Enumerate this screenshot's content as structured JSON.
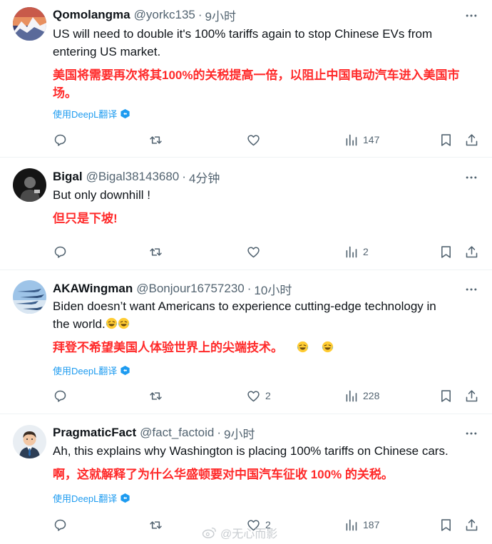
{
  "tweets": [
    {
      "name": "Qomolangma",
      "handle": "@yorkc135",
      "time": "9小时",
      "text_line1": "US will need to double it's 100% tariffs again to stop Chinese EVs from",
      "text_line2": "entering  US market.",
      "translation_line1": "美国将需要再次将其100%的关税提高一倍，以阻止中国电动汽车进入美国市",
      "translation_line2": "场。",
      "translate_link": "使用DeepL翻译",
      "likes": "",
      "views": "147"
    },
    {
      "name": "Bigal",
      "handle": "@Bigal38143680",
      "time": "4分钟",
      "text_line1": "But only downhill !",
      "translation_line1": "但只是下坡!",
      "likes": "",
      "views": "2"
    },
    {
      "name": "AKAWingman",
      "handle": "@Bonjour16757230",
      "time": "10小时",
      "text_line1": "Biden doesn’t want Americans to experience cutting-edge technology in",
      "text_line2": "the world.",
      "translation_line1": "拜登不希望美国人体验世界上的尖端技术。",
      "translate_link": "使用DeepL翻译",
      "likes": "2",
      "views": "228"
    },
    {
      "name": "PragmaticFact",
      "handle": "@fact_factoid",
      "time": "9小时",
      "text_line1": "Ah, this explains why Washington is placing 100% tariffs on Chinese cars.",
      "translation_line1": "啊，这就解释了为什么华盛顿要对中国汽车征收 100% 的关税。",
      "translate_link": "使用DeepL翻译",
      "likes": "2",
      "views": "187"
    }
  ],
  "separator": "·",
  "watermark": "@无心而影",
  "colors": {
    "translation": "#ff2a2a",
    "link": "#1d9bf0",
    "muted": "#536471"
  },
  "icons": [
    "more-icon",
    "reply-icon",
    "retweet-icon",
    "like-icon",
    "views-icon",
    "bookmark-icon",
    "share-icon",
    "translate-icon",
    "laughing-emoji",
    "weibo-icon"
  ]
}
